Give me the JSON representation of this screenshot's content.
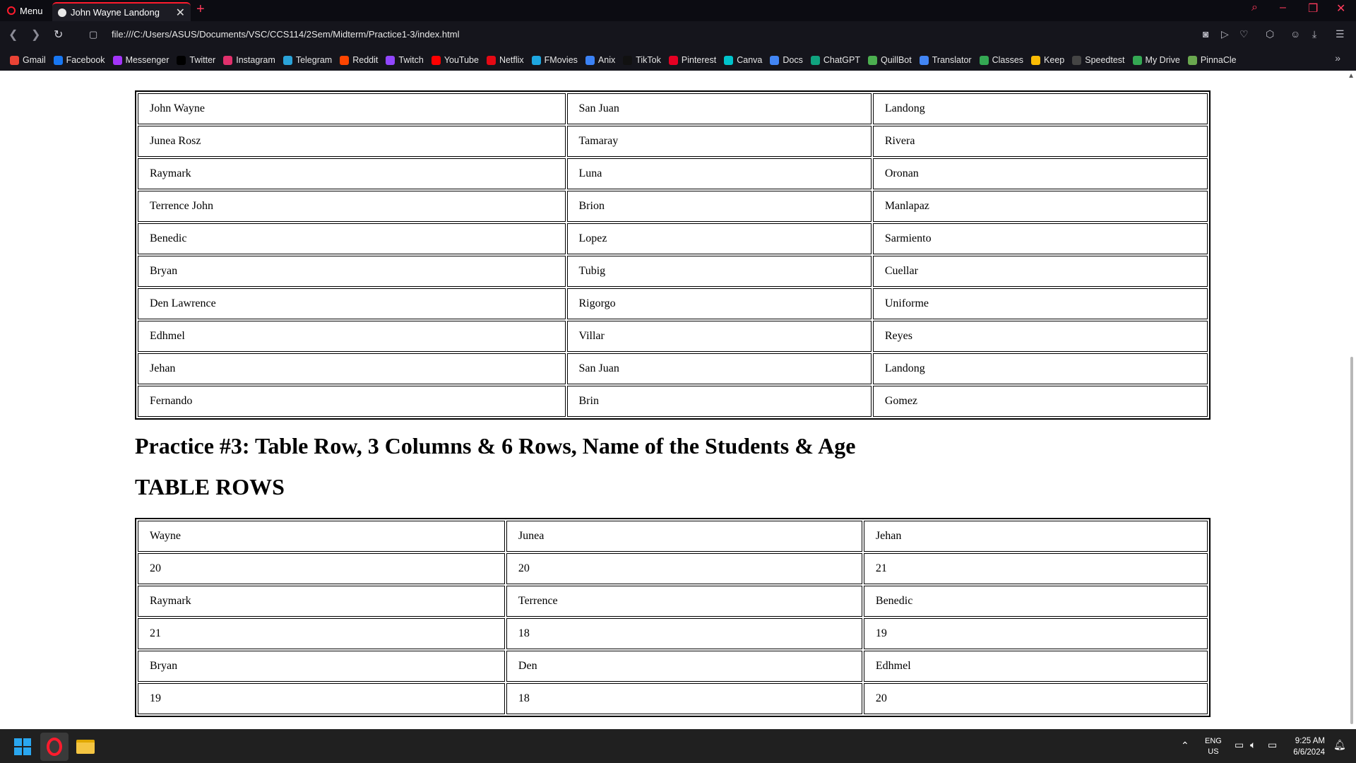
{
  "browser": {
    "menu_label": "Menu",
    "tab_title": "John Wayne Landong",
    "url": "file:///C:/Users/ASUS/Documents/VSC/CCS114/2Sem/Midterm/Practice1-3/index.html",
    "bookmarks": [
      "Gmail",
      "Facebook",
      "Messenger",
      "Twitter",
      "Instagram",
      "Telegram",
      "Reddit",
      "Twitch",
      "YouTube",
      "Netflix",
      "FMovies",
      "Anix",
      "TikTok",
      "Pinterest",
      "Canva",
      "Docs",
      "ChatGPT",
      "QuillBot",
      "Translator",
      "Classes",
      "Keep",
      "Speedtest",
      "My Drive",
      "PinnaCle"
    ],
    "bookmark_colors": [
      "#ea4335",
      "#1877f2",
      "#a334fa",
      "#000000",
      "#e1306c",
      "#2aa3d9",
      "#ff4500",
      "#9146ff",
      "#ff0000",
      "#e50914",
      "#1ea7e1",
      "#3b82f6",
      "#111111",
      "#e60023",
      "#00c4cc",
      "#4285f4",
      "#10a37f",
      "#4caf50",
      "#4285f4",
      "#34a853",
      "#fbbc04",
      "#444444",
      "#34a853",
      "#6aa84f"
    ],
    "accent": "#ff1b2d"
  },
  "page": {
    "table1": [
      [
        "John Wayne",
        "San Juan",
        "Landong"
      ],
      [
        "Junea Rosz",
        "Tamaray",
        "Rivera"
      ],
      [
        "Raymark",
        "Luna",
        "Oronan"
      ],
      [
        "Terrence John",
        "Brion",
        "Manlapaz"
      ],
      [
        "Benedic",
        "Lopez",
        "Sarmiento"
      ],
      [
        "Bryan",
        "Tubig",
        "Cuellar"
      ],
      [
        "Den Lawrence",
        "Rigorgo",
        "Uniforme"
      ],
      [
        "Edhmel",
        "Villar",
        "Reyes"
      ],
      [
        "Jehan",
        "San Juan",
        "Landong"
      ],
      [
        "Fernando",
        "Brin",
        "Gomez"
      ]
    ],
    "heading_practice": "Practice #3: Table Row, 3 Columns & 6 Rows, Name of the Students & Age",
    "heading_rows": "TABLE ROWS",
    "table2": [
      [
        "Wayne",
        "Junea",
        "Jehan"
      ],
      [
        "20",
        "20",
        "21"
      ],
      [
        "Raymark",
        "Terrence",
        "Benedic"
      ],
      [
        "21",
        "18",
        "19"
      ],
      [
        "Bryan",
        "Den",
        "Edhmel"
      ],
      [
        "19",
        "18",
        "20"
      ]
    ]
  },
  "taskbar": {
    "lang": "ENG",
    "region": "US",
    "time": "9:25 AM",
    "date": "6/6/2024"
  }
}
